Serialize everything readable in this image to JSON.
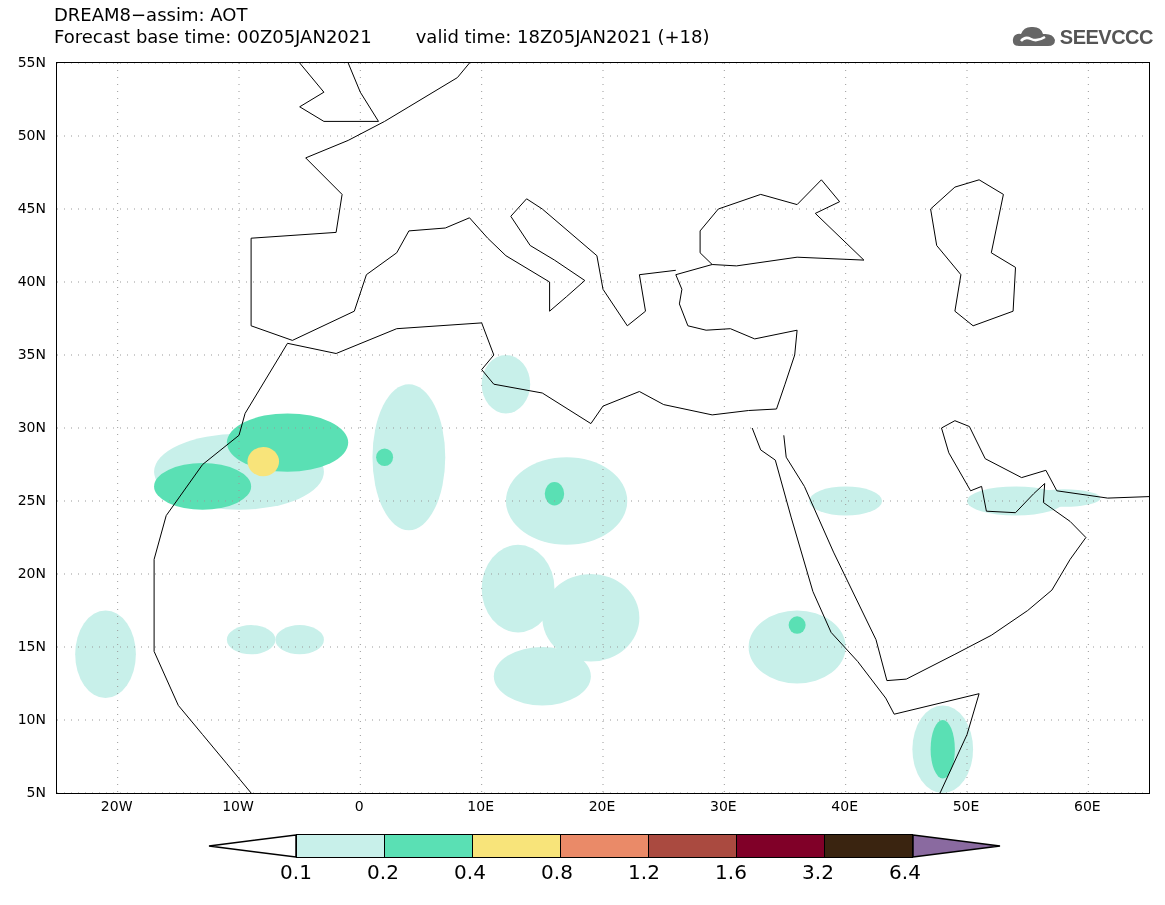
{
  "header": {
    "title": "DREAM8−assim: AOT",
    "base_time": "Forecast base time: 00Z05JAN2021",
    "valid_time": "valid time: 18Z05JAN2021 (+18)",
    "logo_text": "SEEVCCC"
  },
  "map": {
    "y_axis_labels": [
      "55N",
      "50N",
      "45N",
      "40N",
      "35N",
      "30N",
      "25N",
      "20N",
      "15N",
      "10N",
      "5N"
    ],
    "x_axis_labels": [
      "20W",
      "10W",
      "0",
      "10E",
      "20E",
      "30E",
      "40E",
      "50E",
      "60E"
    ]
  },
  "colorbar": {
    "bins": [
      {
        "color": "#c8f0ea",
        "label": "0.1"
      },
      {
        "color": "#5ae0b4",
        "label": "0.2"
      },
      {
        "color": "#f8e47a",
        "label": "0.4"
      },
      {
        "color": "#ea8a68",
        "label": "0.8"
      },
      {
        "color": "#aa4a40",
        "label": "1.2"
      },
      {
        "color": "#800028",
        "label": "1.6"
      },
      {
        "color": "#3a2410",
        "label": "3.2"
      }
    ],
    "over": {
      "color": "#8a6aa0",
      "label": "6.4"
    }
  }
}
